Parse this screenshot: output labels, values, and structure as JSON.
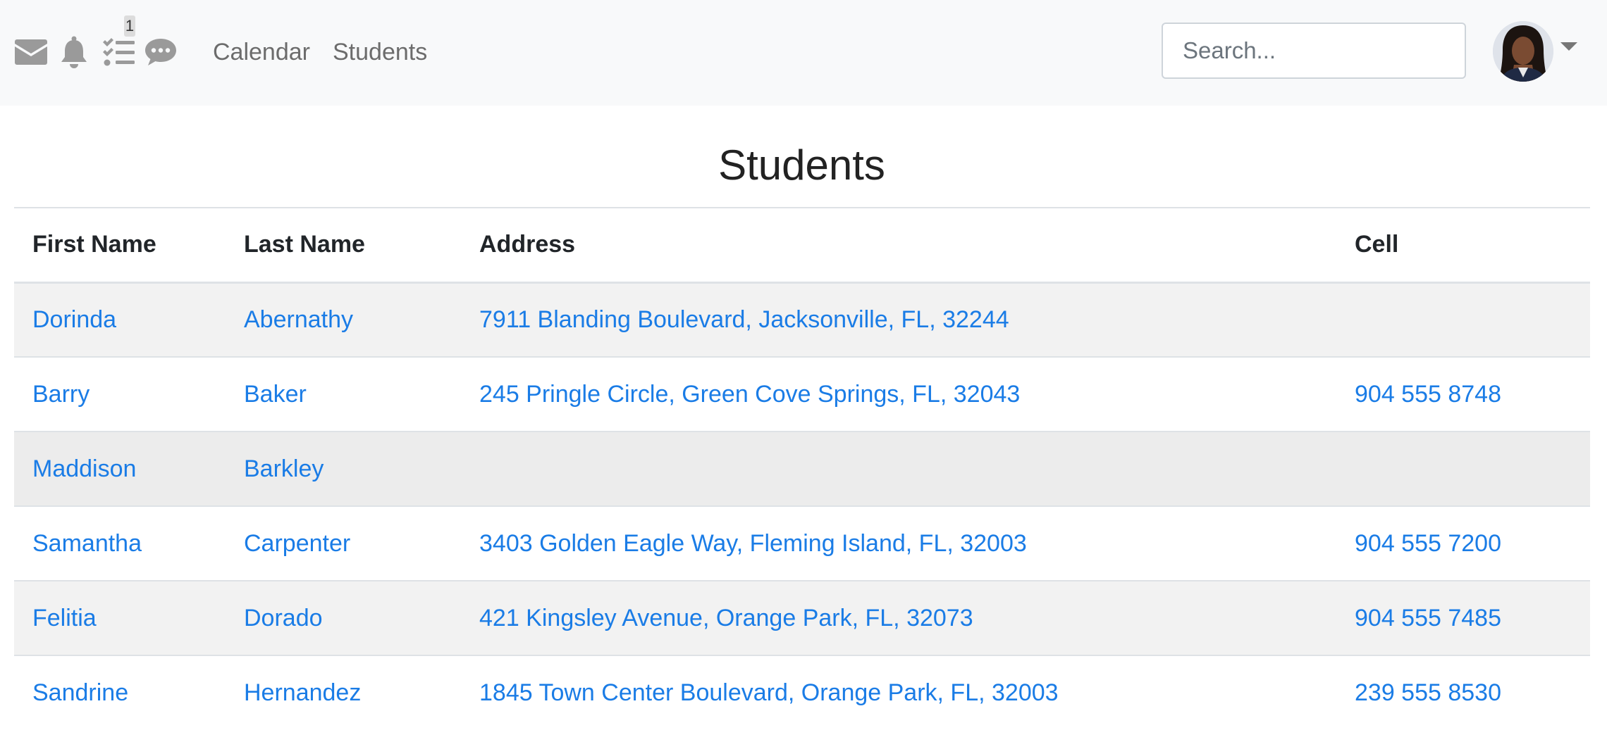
{
  "nav": {
    "icons": [
      "envelope-icon",
      "bell-icon",
      "tasks-icon",
      "comment-icon"
    ],
    "tasks_badge": "1",
    "links": [
      "Calendar",
      "Students"
    ]
  },
  "search": {
    "placeholder": "Search..."
  },
  "page": {
    "title": "Students"
  },
  "table": {
    "headers": [
      "First Name",
      "Last Name",
      "Address",
      "Cell"
    ],
    "rows": [
      {
        "first": "Dorinda",
        "last": "Abernathy",
        "address": "7911 Blanding Boulevard, Jacksonville, FL, 32244",
        "cell": ""
      },
      {
        "first": "Barry",
        "last": "Baker",
        "address": "245 Pringle Circle, Green Cove Springs, FL, 32043",
        "cell": "904 555 8748"
      },
      {
        "first": "Maddison",
        "last": "Barkley",
        "address": "",
        "cell": ""
      },
      {
        "first": "Samantha",
        "last": "Carpenter",
        "address": "3403 Golden Eagle Way, Fleming Island, FL, 32003",
        "cell": "904 555 7200"
      },
      {
        "first": "Felitia",
        "last": "Dorado",
        "address": "421 Kingsley Avenue, Orange Park, FL, 32073",
        "cell": "904 555 7485"
      },
      {
        "first": "Sandrine",
        "last": "Hernandez",
        "address": "1845 Town Center Boulevard, Orange Park, FL, 32003",
        "cell": "239 555 8530"
      }
    ]
  },
  "colors": {
    "link": "#1a7ce6",
    "navbar_bg": "#f8f9fa",
    "stripe": "#f2f2f2"
  }
}
